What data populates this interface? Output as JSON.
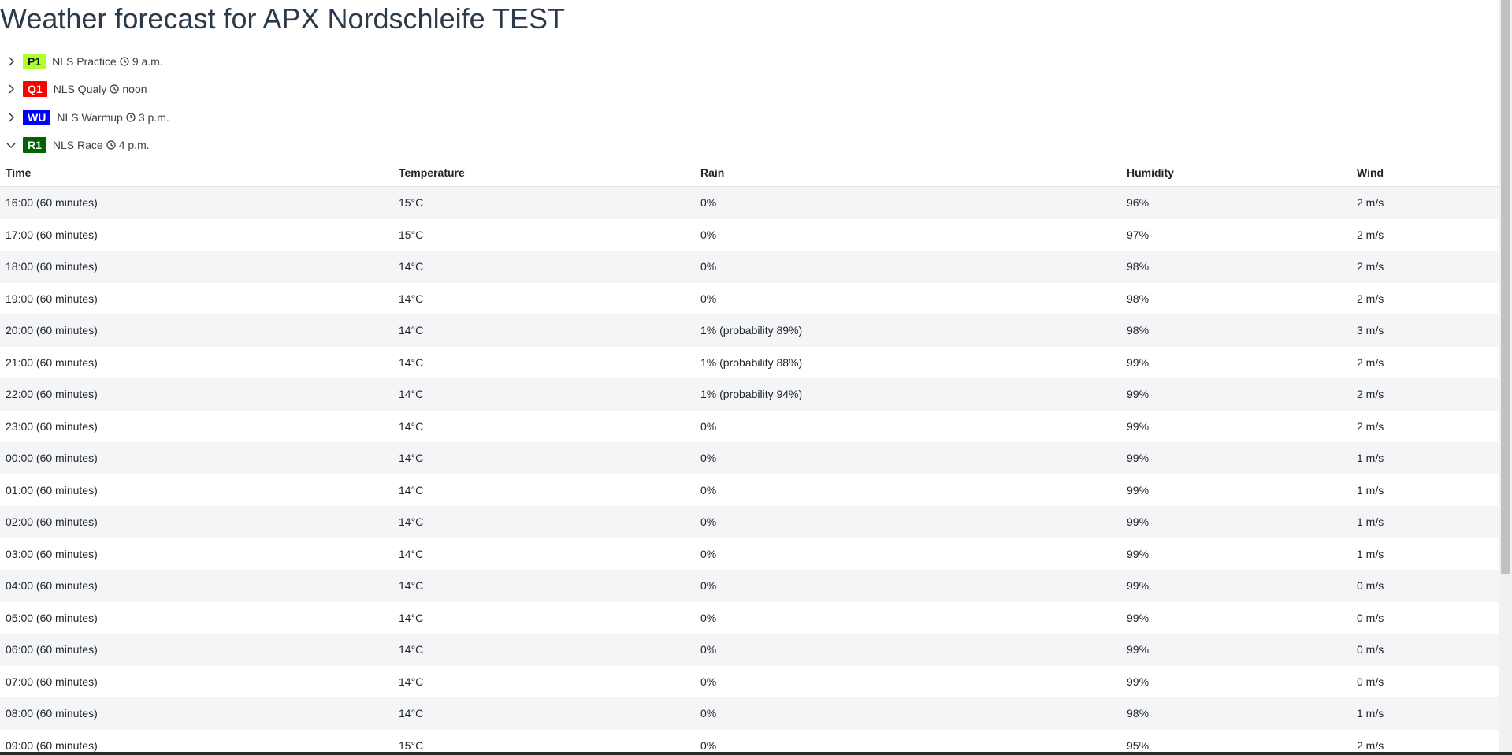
{
  "page_title": "Weather forecast for APX Nordschleife TEST",
  "sessions": [
    {
      "badge": "P1",
      "badge_bg": "#adff2f",
      "badge_fg": "#1a1a1a",
      "name": "NLS Practice",
      "time": "9 a.m.",
      "expanded": false
    },
    {
      "badge": "Q1",
      "badge_bg": "#ff0000",
      "badge_fg": "#ffffff",
      "name": "NLS Qualy",
      "time": "noon",
      "expanded": false
    },
    {
      "badge": "WU",
      "badge_bg": "#0000ff",
      "badge_fg": "#ffffff",
      "name": "NLS Warmup",
      "time": "3 p.m.",
      "expanded": false
    },
    {
      "badge": "R1",
      "badge_bg": "#006400",
      "badge_fg": "#ffffff",
      "name": "NLS Race",
      "time": "4 p.m.",
      "expanded": true
    }
  ],
  "table": {
    "columns": [
      "Time",
      "Temperature",
      "Rain",
      "Humidity",
      "Wind"
    ],
    "rows": [
      [
        "16:00 (60 minutes)",
        "15°C",
        "0%",
        "96%",
        "2 m/s"
      ],
      [
        "17:00 (60 minutes)",
        "15°C",
        "0%",
        "97%",
        "2 m/s"
      ],
      [
        "18:00 (60 minutes)",
        "14°C",
        "0%",
        "98%",
        "2 m/s"
      ],
      [
        "19:00 (60 minutes)",
        "14°C",
        "0%",
        "98%",
        "2 m/s"
      ],
      [
        "20:00 (60 minutes)",
        "14°C",
        "1% (probability 89%)",
        "98%",
        "3 m/s"
      ],
      [
        "21:00 (60 minutes)",
        "14°C",
        "1% (probability 88%)",
        "99%",
        "2 m/s"
      ],
      [
        "22:00 (60 minutes)",
        "14°C",
        "1% (probability 94%)",
        "99%",
        "2 m/s"
      ],
      [
        "23:00 (60 minutes)",
        "14°C",
        "0%",
        "99%",
        "2 m/s"
      ],
      [
        "00:00 (60 minutes)",
        "14°C",
        "0%",
        "99%",
        "1 m/s"
      ],
      [
        "01:00 (60 minutes)",
        "14°C",
        "0%",
        "99%",
        "1 m/s"
      ],
      [
        "02:00 (60 minutes)",
        "14°C",
        "0%",
        "99%",
        "1 m/s"
      ],
      [
        "03:00 (60 minutes)",
        "14°C",
        "0%",
        "99%",
        "1 m/s"
      ],
      [
        "04:00 (60 minutes)",
        "14°C",
        "0%",
        "99%",
        "0 m/s"
      ],
      [
        "05:00 (60 minutes)",
        "14°C",
        "0%",
        "99%",
        "0 m/s"
      ],
      [
        "06:00 (60 minutes)",
        "14°C",
        "0%",
        "99%",
        "0 m/s"
      ],
      [
        "07:00 (60 minutes)",
        "14°C",
        "0%",
        "99%",
        "0 m/s"
      ],
      [
        "08:00 (60 minutes)",
        "14°C",
        "0%",
        "98%",
        "1 m/s"
      ],
      [
        "09:00 (60 minutes)",
        "15°C",
        "0%",
        "95%",
        "2 m/s"
      ]
    ]
  }
}
